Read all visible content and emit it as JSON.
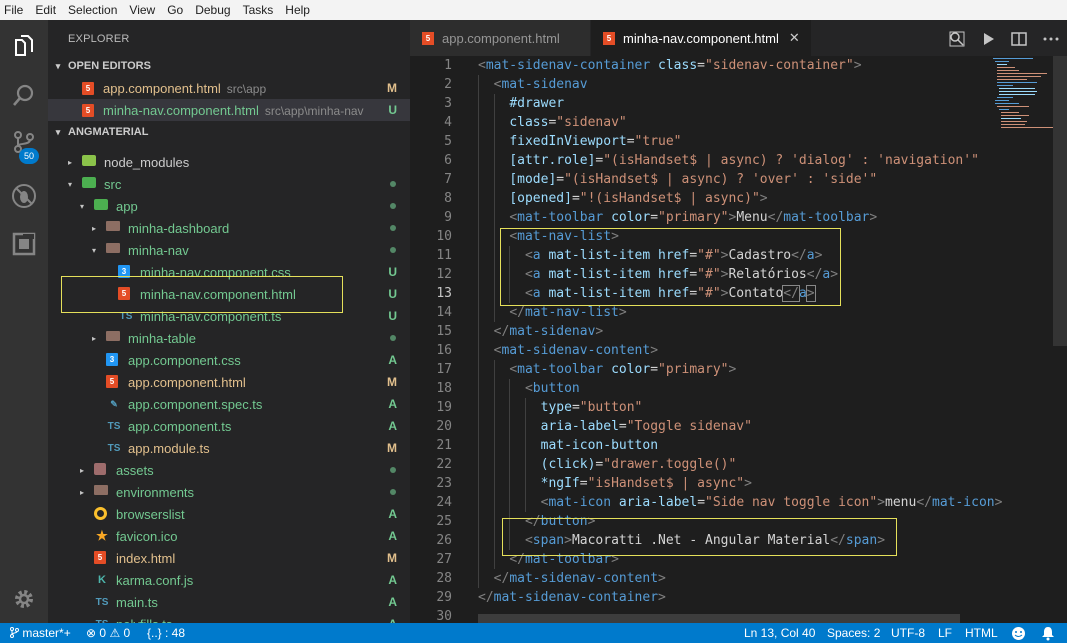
{
  "menu": [
    "File",
    "Edit",
    "Selection",
    "View",
    "Go",
    "Debug",
    "Tasks",
    "Help"
  ],
  "activity": {
    "scm_badge": "50",
    "icons": [
      "files-icon",
      "search-icon",
      "source-control-icon",
      "debug-icon",
      "extensions-icon",
      "settings-gear-icon"
    ]
  },
  "sidebar": {
    "title": "EXPLORER",
    "open_editors": {
      "title": "OPEN EDITORS",
      "items": [
        {
          "name": "app.component.html",
          "desc": "src\\app",
          "status": "M",
          "status_color": "#e2c08d",
          "name_color": "#e2c08d"
        },
        {
          "name": "minha-nav.component.html",
          "desc": "src\\app\\minha-nav",
          "status": "U",
          "status_color": "#73c991",
          "name_color": "#73c991"
        }
      ]
    },
    "project": {
      "title": "ANGMATERIAL",
      "tree": [
        {
          "name": "node_modules",
          "indent": 0,
          "arrow": "▸",
          "icon": "node",
          "color": "#cccccc",
          "mark": "",
          "dot": ""
        },
        {
          "name": "src",
          "indent": 0,
          "arrow": "▾",
          "icon": "src",
          "color": "#73c991",
          "mark": "",
          "dot": "#73c991"
        },
        {
          "name": "app",
          "indent": 1,
          "arrow": "▾",
          "icon": "src",
          "color": "#73c991",
          "mark": "",
          "dot": "#73c991"
        },
        {
          "name": "minha-dashboard",
          "indent": 2,
          "arrow": "▸",
          "icon": "folder",
          "color": "#73c991",
          "mark": "",
          "dot": "#73c991"
        },
        {
          "name": "minha-nav",
          "indent": 2,
          "arrow": "▾",
          "icon": "folder",
          "color": "#73c991",
          "mark": "",
          "dot": "#73c991"
        },
        {
          "name": "minha-nav.component.css",
          "indent": 3,
          "arrow": "",
          "icon": "css",
          "color": "#73c991",
          "mark": "U",
          "dot": ""
        },
        {
          "name": "minha-nav.component.html",
          "indent": 3,
          "arrow": "",
          "icon": "html",
          "color": "#73c991",
          "mark": "U",
          "dot": ""
        },
        {
          "name": "minha-nav.component.ts",
          "indent": 3,
          "arrow": "",
          "icon": "ts",
          "color": "#73c991",
          "mark": "U",
          "dot": ""
        },
        {
          "name": "minha-table",
          "indent": 2,
          "arrow": "▸",
          "icon": "folder",
          "color": "#73c991",
          "mark": "",
          "dot": "#73c991"
        },
        {
          "name": "app.component.css",
          "indent": 2,
          "arrow": "",
          "icon": "css",
          "color": "#73c991",
          "mark": "A",
          "dot": ""
        },
        {
          "name": "app.component.html",
          "indent": 2,
          "arrow": "",
          "icon": "html",
          "color": "#e2c08d",
          "mark": "M",
          "dot": ""
        },
        {
          "name": "app.component.spec.ts",
          "indent": 2,
          "arrow": "",
          "icon": "spec",
          "color": "#73c991",
          "mark": "A",
          "dot": ""
        },
        {
          "name": "app.component.ts",
          "indent": 2,
          "arrow": "",
          "icon": "ts",
          "color": "#73c991",
          "mark": "A",
          "dot": ""
        },
        {
          "name": "app.module.ts",
          "indent": 2,
          "arrow": "",
          "icon": "ts",
          "color": "#e2c08d",
          "mark": "M",
          "dot": ""
        },
        {
          "name": "assets",
          "indent": 1,
          "arrow": "▸",
          "icon": "assets",
          "color": "#73c991",
          "mark": "",
          "dot": "#73c991"
        },
        {
          "name": "environments",
          "indent": 1,
          "arrow": "▸",
          "icon": "folder",
          "color": "#73c991",
          "mark": "",
          "dot": "#73c991"
        },
        {
          "name": "browserslist",
          "indent": 1,
          "arrow": "",
          "icon": "browsers",
          "color": "#73c991",
          "mark": "A",
          "dot": ""
        },
        {
          "name": "favicon.ico",
          "indent": 1,
          "arrow": "",
          "icon": "favicon",
          "color": "#73c991",
          "mark": "A",
          "dot": ""
        },
        {
          "name": "index.html",
          "indent": 1,
          "arrow": "",
          "icon": "html",
          "color": "#e2c08d",
          "mark": "M",
          "dot": ""
        },
        {
          "name": "karma.conf.js",
          "indent": 1,
          "arrow": "",
          "icon": "karma",
          "color": "#73c991",
          "mark": "A",
          "dot": ""
        },
        {
          "name": "main.ts",
          "indent": 1,
          "arrow": "",
          "icon": "ts",
          "color": "#73c991",
          "mark": "A",
          "dot": ""
        },
        {
          "name": "polyfills.ts",
          "indent": 1,
          "arrow": "",
          "icon": "ts",
          "color": "#73c991",
          "mark": "A",
          "dot": ""
        }
      ]
    }
  },
  "tabs": [
    {
      "label": "app.component.html",
      "active": false
    },
    {
      "label": "minha-nav.component.html",
      "active": true,
      "close": "✕"
    }
  ],
  "editor": {
    "current_line": 13,
    "lines": [
      {
        "n": 1,
        "indent": 0,
        "tokens": [
          [
            "p",
            "<"
          ],
          [
            "t",
            "mat-sidenav-container"
          ],
          [
            "x",
            " "
          ],
          [
            "a",
            "class"
          ],
          [
            "x",
            "="
          ],
          [
            "s",
            "\"sidenav-container\""
          ],
          [
            "p",
            ">"
          ]
        ]
      },
      {
        "n": 2,
        "indent": 1,
        "tokens": [
          [
            "p",
            "<"
          ],
          [
            "t",
            "mat-sidenav"
          ]
        ]
      },
      {
        "n": 3,
        "indent": 2,
        "tokens": [
          [
            "a",
            "#drawer"
          ]
        ]
      },
      {
        "n": 4,
        "indent": 2,
        "tokens": [
          [
            "a",
            "class"
          ],
          [
            "x",
            "="
          ],
          [
            "s",
            "\"sidenav\""
          ]
        ]
      },
      {
        "n": 5,
        "indent": 2,
        "tokens": [
          [
            "a",
            "fixedInViewport"
          ],
          [
            "x",
            "="
          ],
          [
            "s",
            "\"true\""
          ]
        ]
      },
      {
        "n": 6,
        "indent": 2,
        "tokens": [
          [
            "a",
            "[attr.role]"
          ],
          [
            "x",
            "="
          ],
          [
            "s",
            "\"(isHandset$ | async) ? 'dialog' : 'navigation'\""
          ]
        ]
      },
      {
        "n": 7,
        "indent": 2,
        "tokens": [
          [
            "a",
            "[mode]"
          ],
          [
            "x",
            "="
          ],
          [
            "s",
            "\"(isHandset$ | async) ? 'over' : 'side'\""
          ]
        ]
      },
      {
        "n": 8,
        "indent": 2,
        "tokens": [
          [
            "a",
            "[opened]"
          ],
          [
            "x",
            "="
          ],
          [
            "s",
            "\"!(isHandset$ | async)\""
          ],
          [
            "p",
            ">"
          ]
        ]
      },
      {
        "n": 9,
        "indent": 2,
        "tokens": [
          [
            "p",
            "<"
          ],
          [
            "t",
            "mat-toolbar"
          ],
          [
            "x",
            " "
          ],
          [
            "a",
            "color"
          ],
          [
            "x",
            "="
          ],
          [
            "s",
            "\"primary\""
          ],
          [
            "p",
            ">"
          ],
          [
            "x",
            "Menu"
          ],
          [
            "p",
            "</"
          ],
          [
            "t",
            "mat-toolbar"
          ],
          [
            "p",
            ">"
          ]
        ]
      },
      {
        "n": 10,
        "indent": 2,
        "tokens": [
          [
            "p",
            "<"
          ],
          [
            "t",
            "mat-nav-list"
          ],
          [
            "p",
            ">"
          ]
        ]
      },
      {
        "n": 11,
        "indent": 3,
        "tokens": [
          [
            "p",
            "<"
          ],
          [
            "t",
            "a"
          ],
          [
            "x",
            " "
          ],
          [
            "a",
            "mat-list-item"
          ],
          [
            "x",
            " "
          ],
          [
            "a",
            "href"
          ],
          [
            "x",
            "="
          ],
          [
            "s",
            "\"#\""
          ],
          [
            "p",
            ">"
          ],
          [
            "x",
            "Cadastro"
          ],
          [
            "p",
            "</"
          ],
          [
            "t",
            "a"
          ],
          [
            "p",
            ">"
          ]
        ]
      },
      {
        "n": 12,
        "indent": 3,
        "tokens": [
          [
            "p",
            "<"
          ],
          [
            "t",
            "a"
          ],
          [
            "x",
            " "
          ],
          [
            "a",
            "mat-list-item"
          ],
          [
            "x",
            " "
          ],
          [
            "a",
            "href"
          ],
          [
            "x",
            "="
          ],
          [
            "s",
            "\"#\""
          ],
          [
            "p",
            ">"
          ],
          [
            "x",
            "Relatórios"
          ],
          [
            "p",
            "</"
          ],
          [
            "t",
            "a"
          ],
          [
            "p",
            ">"
          ]
        ]
      },
      {
        "n": 13,
        "indent": 3,
        "tokens": [
          [
            "p",
            "<"
          ],
          [
            "t",
            "a"
          ],
          [
            "x",
            " "
          ],
          [
            "a",
            "mat-list-item"
          ],
          [
            "x",
            " "
          ],
          [
            "a",
            "href"
          ],
          [
            "x",
            "="
          ],
          [
            "s",
            "\"#\""
          ],
          [
            "p",
            ">"
          ],
          [
            "x",
            "Contato"
          ],
          [
            "pc",
            "</"
          ],
          [
            "t",
            "a"
          ],
          [
            "pc",
            ">"
          ]
        ]
      },
      {
        "n": 14,
        "indent": 2,
        "tokens": [
          [
            "p",
            "</"
          ],
          [
            "t",
            "mat-nav-list"
          ],
          [
            "p",
            ">"
          ]
        ]
      },
      {
        "n": 15,
        "indent": 1,
        "tokens": [
          [
            "p",
            "</"
          ],
          [
            "t",
            "mat-sidenav"
          ],
          [
            "p",
            ">"
          ]
        ]
      },
      {
        "n": 16,
        "indent": 1,
        "tokens": [
          [
            "p",
            "<"
          ],
          [
            "t",
            "mat-sidenav-content"
          ],
          [
            "p",
            ">"
          ]
        ]
      },
      {
        "n": 17,
        "indent": 2,
        "tokens": [
          [
            "p",
            "<"
          ],
          [
            "t",
            "mat-toolbar"
          ],
          [
            "x",
            " "
          ],
          [
            "a",
            "color"
          ],
          [
            "x",
            "="
          ],
          [
            "s",
            "\"primary\""
          ],
          [
            "p",
            ">"
          ]
        ]
      },
      {
        "n": 18,
        "indent": 3,
        "tokens": [
          [
            "p",
            "<"
          ],
          [
            "t",
            "button"
          ]
        ]
      },
      {
        "n": 19,
        "indent": 4,
        "tokens": [
          [
            "a",
            "type"
          ],
          [
            "x",
            "="
          ],
          [
            "s",
            "\"button\""
          ]
        ]
      },
      {
        "n": 20,
        "indent": 4,
        "tokens": [
          [
            "a",
            "aria-label"
          ],
          [
            "x",
            "="
          ],
          [
            "s",
            "\"Toggle sidenav\""
          ]
        ]
      },
      {
        "n": 21,
        "indent": 4,
        "tokens": [
          [
            "a",
            "mat-icon-button"
          ]
        ]
      },
      {
        "n": 22,
        "indent": 4,
        "tokens": [
          [
            "a",
            "(click)"
          ],
          [
            "x",
            "="
          ],
          [
            "s",
            "\"drawer.toggle()\""
          ]
        ]
      },
      {
        "n": 23,
        "indent": 4,
        "tokens": [
          [
            "a",
            "*ngIf"
          ],
          [
            "x",
            "="
          ],
          [
            "s",
            "\"isHandset$ | async\""
          ],
          [
            "p",
            ">"
          ]
        ]
      },
      {
        "n": 24,
        "indent": 4,
        "tokens": [
          [
            "p",
            "<"
          ],
          [
            "t",
            "mat-icon"
          ],
          [
            "x",
            " "
          ],
          [
            "a",
            "aria-label"
          ],
          [
            "x",
            "="
          ],
          [
            "s",
            "\"Side nav toggle icon\""
          ],
          [
            "p",
            ">"
          ],
          [
            "x",
            "menu"
          ],
          [
            "p",
            "</"
          ],
          [
            "t",
            "mat-icon"
          ],
          [
            "p",
            ">"
          ]
        ]
      },
      {
        "n": 25,
        "indent": 3,
        "tokens": [
          [
            "p",
            "</"
          ],
          [
            "t",
            "button"
          ],
          [
            "p",
            ">"
          ]
        ]
      },
      {
        "n": 26,
        "indent": 3,
        "tokens": [
          [
            "p",
            "<"
          ],
          [
            "t",
            "span"
          ],
          [
            "p",
            ">"
          ],
          [
            "x",
            "Macoratti .Net - Angular Material"
          ],
          [
            "p",
            "</"
          ],
          [
            "t",
            "span"
          ],
          [
            "p",
            ">"
          ]
        ]
      },
      {
        "n": 27,
        "indent": 2,
        "tokens": [
          [
            "p",
            "</"
          ],
          [
            "t",
            "mat-toolbar"
          ],
          [
            "p",
            ">"
          ]
        ]
      },
      {
        "n": 28,
        "indent": 1,
        "tokens": [
          [
            "p",
            "</"
          ],
          [
            "t",
            "mat-sidenav-content"
          ],
          [
            "p",
            ">"
          ]
        ]
      },
      {
        "n": 29,
        "indent": 0,
        "tokens": [
          [
            "p",
            "</"
          ],
          [
            "t",
            "mat-sidenav-container"
          ],
          [
            "p",
            ">"
          ]
        ]
      },
      {
        "n": 30,
        "indent": 0,
        "tokens": []
      }
    ]
  },
  "statusbar": {
    "branch": "master*+",
    "errors": "0",
    "warnings": "0",
    "braces": "{..} : 48",
    "position": "Ln 13, Col 40",
    "spaces": "Spaces: 2",
    "encoding": "UTF-8",
    "eol": "LF",
    "language": "HTML"
  }
}
